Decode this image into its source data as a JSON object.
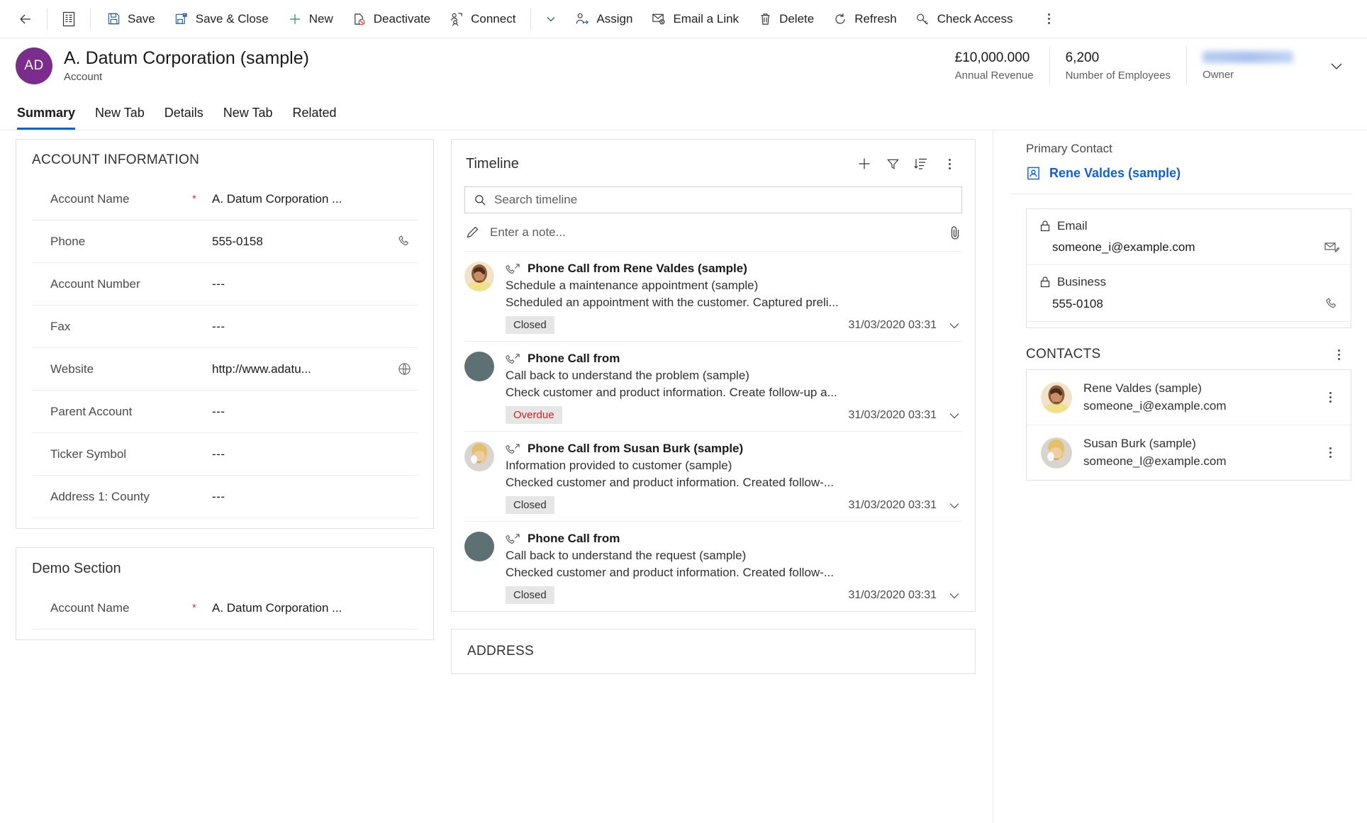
{
  "commandbar": {
    "back_icon": "back-arrow-icon",
    "form_selector_icon": "form-list-icon",
    "buttons": [
      {
        "label": "Save",
        "icon": "save-icon"
      },
      {
        "label": "Save & Close",
        "icon": "save-and-close-icon"
      },
      {
        "label": "New",
        "icon": "plus-icon"
      },
      {
        "label": "Deactivate",
        "icon": "deactivate-icon"
      },
      {
        "label": "Connect",
        "icon": "connect-icon"
      }
    ],
    "buttons2": [
      {
        "label": "Assign",
        "icon": "assign-icon"
      },
      {
        "label": "Email a Link",
        "icon": "email-link-icon"
      },
      {
        "label": "Delete",
        "icon": "trash-icon"
      },
      {
        "label": "Refresh",
        "icon": "refresh-icon"
      },
      {
        "label": "Check Access",
        "icon": "key-icon"
      }
    ],
    "overflow_icon": "more-vertical-icon"
  },
  "header": {
    "avatar_initials": "AD",
    "title": "A. Datum Corporation (sample)",
    "subtitle": "Account",
    "stats": [
      {
        "value": "£10,000.000",
        "label": "Annual Revenue"
      },
      {
        "value": "6,200",
        "label": "Number of Employees"
      },
      {
        "value": "",
        "label": "Owner",
        "redacted": true
      }
    ],
    "expand_icon": "chevron-down-icon"
  },
  "tabs": [
    {
      "label": "Summary",
      "active": true
    },
    {
      "label": "New Tab",
      "active": false
    },
    {
      "label": "Details",
      "active": false
    },
    {
      "label": "New Tab",
      "active": false
    },
    {
      "label": "Related",
      "active": false
    }
  ],
  "account_information": {
    "title": "ACCOUNT INFORMATION",
    "fields": [
      {
        "label": "Account Name",
        "required": "*",
        "value": "A. Datum Corporation ...",
        "action_icon": ""
      },
      {
        "label": "Phone",
        "required": "",
        "value": "555-0158",
        "action_icon": "phone-icon"
      },
      {
        "label": "Account Number",
        "required": "",
        "value": "---",
        "action_icon": ""
      },
      {
        "label": "Fax",
        "required": "",
        "value": "---",
        "action_icon": ""
      },
      {
        "label": "Website",
        "required": "",
        "value": "http://www.adatu...",
        "action_icon": "globe-icon"
      },
      {
        "label": "Parent Account",
        "required": "",
        "value": "---",
        "action_icon": ""
      },
      {
        "label": "Ticker Symbol",
        "required": "",
        "value": "---",
        "action_icon": ""
      },
      {
        "label": "Address 1: County",
        "required": "",
        "value": "---",
        "action_icon": ""
      }
    ]
  },
  "demo_section": {
    "title": "Demo Section",
    "fields": [
      {
        "label": "Account Name",
        "required": "*",
        "value": "A. Datum Corporation ...",
        "action_icon": ""
      }
    ]
  },
  "timeline": {
    "title": "Timeline",
    "actions": [
      {
        "icon": "plus-icon",
        "name": "create-timeline-record-button"
      },
      {
        "icon": "filter-icon",
        "name": "filter-button"
      },
      {
        "icon": "sort-icon",
        "name": "sort-button"
      },
      {
        "icon": "more-vertical-icon",
        "name": "timeline-more-button"
      }
    ],
    "search_placeholder": "Search timeline",
    "search_value": "",
    "search_icon": "search-icon",
    "note_placeholder": "Enter a note...",
    "note_value": "",
    "note_icon": "pencil-icon",
    "attach_icon": "paperclip-icon",
    "items": [
      {
        "title": "Phone Call from Rene Valdes (sample)",
        "subject": "Schedule a maintenance appointment (sample)",
        "description": "Scheduled an appointment with the customer. Captured preli...",
        "status": "Closed",
        "status_type": "closed",
        "timestamp": "31/03/2020 03:31",
        "call_icon": "incoming-call-icon",
        "avatar": "photo"
      },
      {
        "title": "Phone Call from",
        "subject": "Call back to understand the problem (sample)",
        "description": "Check customer and product information. Create follow-up a...",
        "status": "Overdue",
        "status_type": "overdue",
        "timestamp": "31/03/2020 03:31",
        "call_icon": "outgoing-call-icon",
        "avatar": "placeholder"
      },
      {
        "title": "Phone Call from Susan Burk (sample)",
        "subject": "Information provided to customer (sample)",
        "description": "Checked customer and product information. Created follow-...",
        "status": "Closed",
        "status_type": "closed",
        "timestamp": "31/03/2020 03:31",
        "call_icon": "incoming-call-icon",
        "avatar": "photo2"
      },
      {
        "title": "Phone Call from",
        "subject": "Call back to understand the request (sample)",
        "description": "Checked customer and product information. Created follow-...",
        "status": "Closed",
        "status_type": "closed",
        "timestamp": "31/03/2020 03:31",
        "call_icon": "outgoing-call-icon",
        "avatar": "placeholder"
      }
    ]
  },
  "address_section": {
    "title": "ADDRESS"
  },
  "right_panel": {
    "primary_contact_label": "Primary Contact",
    "primary_contact_name": "Rene Valdes (sample)",
    "primary_contact_icon": "contact-card-icon",
    "quickview": [
      {
        "label": "Email",
        "lock_icon": "lock-icon",
        "value": "someone_i@example.com",
        "action_icon": "email-icon"
      },
      {
        "label": "Business",
        "lock_icon": "lock-icon",
        "value": "555-0108",
        "action_icon": "phone-icon"
      }
    ],
    "contacts_title": "CONTACTS",
    "contacts_more_icon": "more-vertical-icon",
    "contacts": [
      {
        "name": "Rene Valdes (sample)",
        "email": "someone_i@example.com",
        "menu_icon": "more-vertical-icon"
      },
      {
        "name": "Susan Burk (sample)",
        "email": "someone_l@example.com",
        "menu_icon": "more-vertical-icon"
      }
    ]
  },
  "colors": {
    "accent": "#0f62d0",
    "avatar": "#7b2d8b",
    "required": "#d13438",
    "overdue": "#cc2222",
    "badge_bg": "#e6e6e6"
  }
}
